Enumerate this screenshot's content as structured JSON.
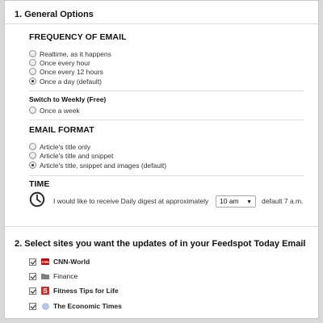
{
  "section1": {
    "title": "1. General Options"
  },
  "frequency": {
    "title": "FREQUENCY OF EMAIL",
    "options": [
      {
        "label": "Realtime, as it happens",
        "checked": false
      },
      {
        "label": "Once every hour",
        "checked": false
      },
      {
        "label": "Once every 12 hours",
        "checked": false
      },
      {
        "label": "Once a day (default)",
        "checked": true
      }
    ]
  },
  "weekly": {
    "title": "Switch to Weekly (Free)",
    "option": {
      "label": "Once a week",
      "checked": false
    }
  },
  "format": {
    "title": "EMAIL FORMAT",
    "options": [
      {
        "label": "Article's title only",
        "checked": false
      },
      {
        "label": "Article's title and snippet",
        "checked": false
      },
      {
        "label": "Article's title, snippet and images (default)",
        "checked": true
      }
    ]
  },
  "time": {
    "title": "TIME",
    "icon": "clock-icon",
    "text": "I would like to receive Daily digest at approximately",
    "selected": "10 am",
    "default_text": "default 7 a.m."
  },
  "section2": {
    "title": "2. Select sites you want the updates of in your Feedspot Today Email",
    "sites": [
      {
        "label": "CNN-World",
        "checked": true,
        "icon": "cnn-icon",
        "bold": true
      },
      {
        "label": "Finance",
        "checked": true,
        "icon": "folder-icon",
        "bold": false
      },
      {
        "label": "Fitness Tips for Life",
        "checked": true,
        "icon": "s-logo-icon",
        "bold": true
      },
      {
        "label": "The Economic Times",
        "checked": true,
        "icon": "globe-icon",
        "bold": true
      }
    ]
  },
  "colors": {
    "cnn_red": "#cc0000",
    "fitness_red": "#d22b2b",
    "folder_gray": "#7f7f7f",
    "globe_blue": "#b9c6ec"
  }
}
